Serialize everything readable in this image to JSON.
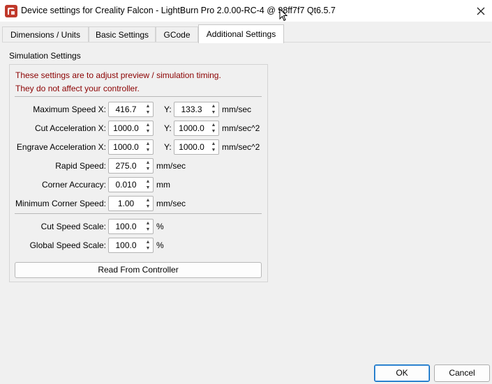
{
  "window": {
    "title": "Device settings for Creality Falcon - LightBurn Pro 2.0.00-RC-4 @ 98ff7f7 Qt6.5.7",
    "icons": {
      "app": "lightburn-app-icon",
      "close": "close-icon"
    }
  },
  "tabs": [
    {
      "label": "Dimensions / Units"
    },
    {
      "label": "Basic Settings"
    },
    {
      "label": "GCode"
    },
    {
      "label": "Additional Settings",
      "active": true
    }
  ],
  "simulation": {
    "group_label": "Simulation Settings",
    "note_line1": "These settings are to adjust preview / simulation timing.",
    "note_line2": "They do not affect your controller.",
    "y_label": "Y:",
    "max_speed": {
      "label": "Maximum Speed X:",
      "x": "416.7",
      "y": "133.3",
      "unit": "mm/sec"
    },
    "cut_accel": {
      "label": "Cut Acceleration X:",
      "x": "1000.0",
      "y": "1000.0",
      "unit": "mm/sec^2"
    },
    "engrave_accel": {
      "label": "Engrave Acceleration X:",
      "x": "1000.0",
      "y": "1000.0",
      "unit": "mm/sec^2"
    },
    "rapid_speed": {
      "label": "Rapid Speed:",
      "value": "275.0",
      "unit": "mm/sec"
    },
    "corner_accuracy": {
      "label": "Corner Accuracy:",
      "value": "0.010",
      "unit": "mm"
    },
    "min_corner_speed": {
      "label": "Minimum Corner Speed:",
      "value": "1.00",
      "unit": "mm/sec"
    },
    "cut_speed_scale": {
      "label": "Cut Speed Scale:",
      "value": "100.0",
      "unit": "%"
    },
    "global_speed_scale": {
      "label": "Global Speed Scale:",
      "value": "100.0",
      "unit": "%"
    },
    "read_button": "Read From Controller"
  },
  "buttons": {
    "ok": "OK",
    "cancel": "Cancel"
  },
  "colors": {
    "note_text": "#8b0000",
    "app_icon": "#c0392b",
    "ok_border": "#0067c0"
  }
}
